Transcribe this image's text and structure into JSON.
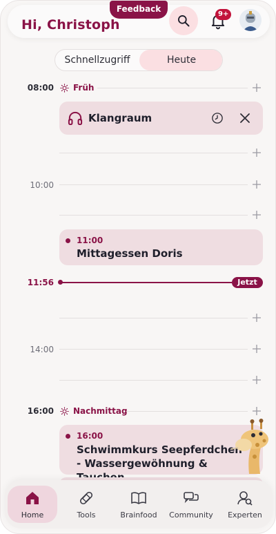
{
  "header": {
    "greeting": "Hi, Christoph",
    "feedback_label": "Feedback",
    "notification_badge": "9+",
    "search_icon": "search-icon",
    "bell_icon": "bell-icon",
    "avatar_icon": "knight-avatar"
  },
  "tabs": {
    "items": [
      {
        "label": "Schnellzugriff",
        "active": false
      },
      {
        "label": "Heute",
        "active": true
      }
    ]
  },
  "timeline": {
    "rows": [
      {
        "time": "08:00",
        "label": "Früh",
        "icon": "sun-icon"
      },
      {
        "time": "10:00"
      },
      {
        "time": "14:00"
      },
      {
        "time": "16:00",
        "label": "Nachmittag",
        "icon": "sun-icon"
      }
    ],
    "now": {
      "time": "11:56",
      "label": "Jetzt"
    }
  },
  "events": [
    {
      "title": "Klangraum",
      "icon": "headphones-icon",
      "actions": [
        "clock-icon",
        "close-icon"
      ]
    },
    {
      "time": "11:00",
      "title": "Mittagessen Doris"
    },
    {
      "time": "16:00",
      "title": "Schwimmkurs Seepferdchen - Wassergewöhnung & Tauchen"
    }
  ],
  "bottom_nav": {
    "items": [
      {
        "label": "Home",
        "icon": "home-icon",
        "active": true
      },
      {
        "label": "Tools",
        "icon": "bandage-icon",
        "active": false
      },
      {
        "label": "Brainfood",
        "icon": "book-icon",
        "active": false
      },
      {
        "label": "Community",
        "icon": "chat-icon",
        "active": false
      },
      {
        "label": "Experten",
        "icon": "expert-icon",
        "active": false
      }
    ]
  },
  "colors": {
    "brand": "#8a1347",
    "card": "#efdde1",
    "highlight": "#fbdfe2",
    "background": "#f8f6f5"
  }
}
